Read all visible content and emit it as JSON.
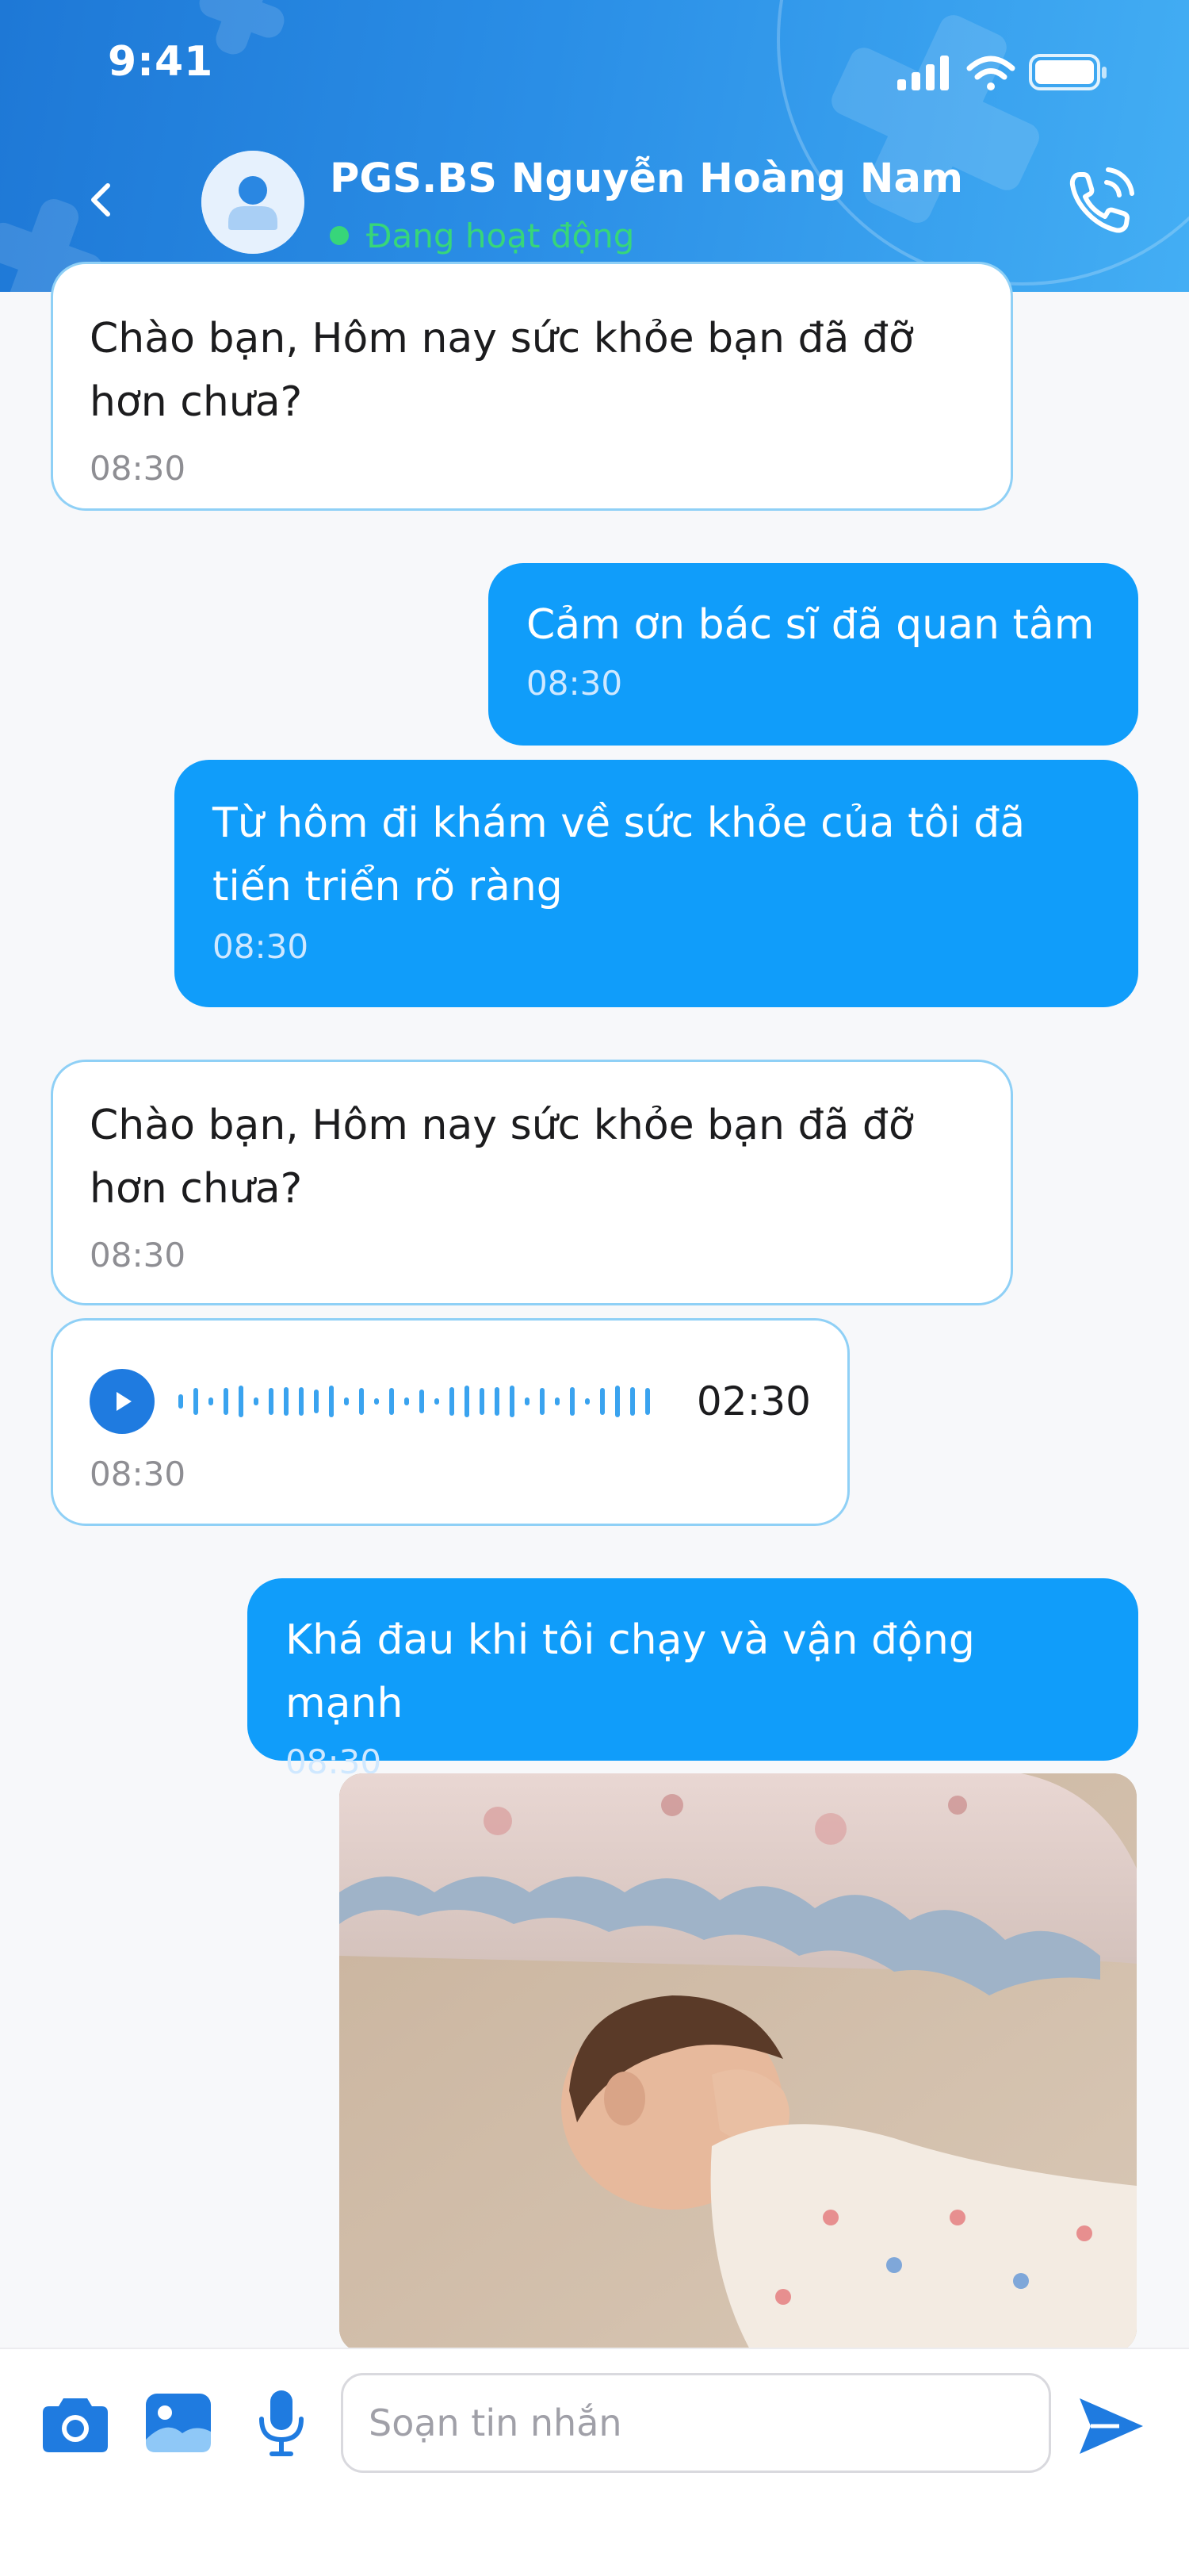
{
  "status_bar": {
    "time": "9:41"
  },
  "header": {
    "doctor_name": "PGS.BS Nguyễn Hoàng Nam",
    "status": "Đang hoạt động",
    "icons": {
      "back": "chevron-left-icon",
      "avatar": "user-avatar-icon",
      "call": "phone-call-icon"
    }
  },
  "messages": [
    {
      "side": "incoming",
      "lines": [
        "Chào bạn, Hôm nay sức khỏe bạn đã đỡ",
        "hơn chưa?"
      ],
      "time": "08:30"
    },
    {
      "side": "outgoing",
      "lines": [
        "Cảm ơn bác sĩ đã quan tâm"
      ],
      "time": "08:30"
    },
    {
      "side": "outgoing",
      "lines": [
        "Từ hôm đi khám về sức khỏe của tôi đã",
        "tiến triển rõ ràng"
      ],
      "time": "08:30"
    },
    {
      "side": "incoming",
      "lines": [
        "Chào bạn, Hôm nay sức khỏe bạn đã đỡ",
        "hơn chưa?"
      ],
      "time": "08:30"
    },
    {
      "side": "incoming",
      "type": "voice",
      "duration": "02:30",
      "time": "08:30"
    },
    {
      "side": "outgoing",
      "lines": [
        "Khá đau khi tôi chạy và vận động mạnh"
      ],
      "time": "08:30"
    },
    {
      "side": "outgoing",
      "type": "image",
      "subject": "sleeping-baby-photo"
    }
  ],
  "composer": {
    "placeholder": "Soạn tin nhắn",
    "icons": [
      "camera-icon",
      "gallery-icon",
      "microphone-icon",
      "send-icon"
    ]
  },
  "colors": {
    "header_gradient_start": "#1e78d6",
    "header_gradient_end": "#43aef4",
    "outgoing_bubble": "#109dfa",
    "incoming_border": "#8fd0f6",
    "online_green": "#37d67a",
    "accent_blue": "#1f7be0"
  }
}
